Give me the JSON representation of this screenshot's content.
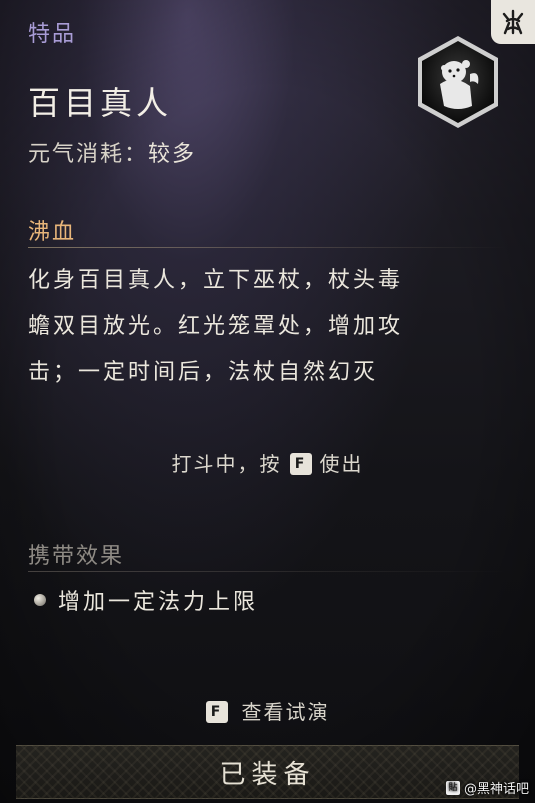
{
  "item": {
    "tier": "特品",
    "name": "百目真人",
    "cost_label": "元气消耗：",
    "cost_value": "较多"
  },
  "ability": {
    "section_title": "沸血",
    "description_lines": [
      "化身百目真人，立下巫杖，杖头毒",
      "蟾双目放光。红光笼罩处，增加攻",
      "击；一定时间后，法杖自然幻灭"
    ]
  },
  "usage_hint": {
    "before": "打斗中，按",
    "key": "F",
    "after": "使出"
  },
  "carry_effect": {
    "section_title": "携带效果",
    "items": [
      "增加一定法力上限"
    ]
  },
  "preview": {
    "key": "F",
    "label": "查看试演"
  },
  "equip_button": {
    "label": "已装备"
  },
  "watermark": {
    "icon": "baidu-paw-icon",
    "icon_text": "貼",
    "text": "@黑神话吧"
  },
  "icons": {
    "corner_badge": "spirit-emblem-icon",
    "portrait": "hundred-eyed-daoist-portrait-icon"
  },
  "colors": {
    "tier": "#a99cd6",
    "ability_title": "#e8b67a",
    "carry_title": "#8e8a84",
    "text": "#ebe7dd"
  }
}
